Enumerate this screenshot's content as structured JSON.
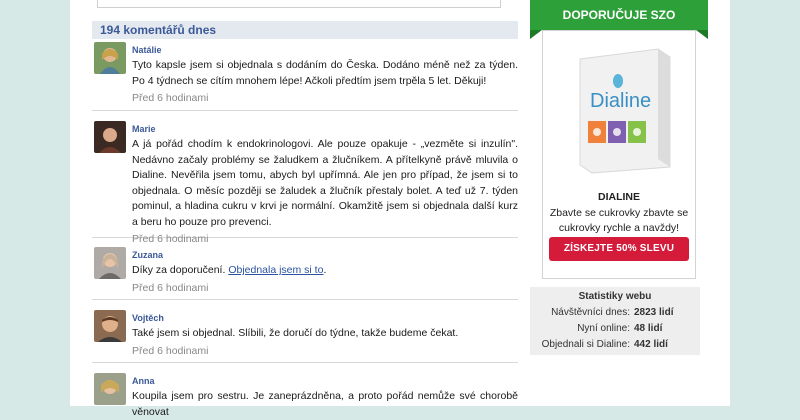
{
  "comments_header": "194 komentářů dnes",
  "comments": [
    {
      "name": "Natálie",
      "text": "Tyto kapsle jsem si objednala s dodáním do Česka. Dodáno méně než za týden. Po 4 týdnech se cítím mnohem lépe! Ačkoli předtím jsem trpěla 5 let. Děkuji!",
      "time": "Před 6 hodinami"
    },
    {
      "name": "Marie",
      "text": "A já pořád chodím k endokrinologovi. Ale pouze opakuje - „vezměte si inzulín\". Nedávno začaly problémy se žaludkem a žlučníkem. A přítelkyně právě mluvila o Dialine. Nevěřila jsem tomu, abych byl upřímná. Ale jen pro případ, že jsem si to objednala. O měsíc později se žaludek a žlučník přestaly bolet. A teď už 7. týden pominul, a hladina cukru v krvi je normální. Okamžitě jsem si objednala další kurz a beru ho pouze pro prevenci.",
      "time": "Před 6 hodinami"
    },
    {
      "name": "Zuzana",
      "text": "Díky za doporučení. ",
      "link": "Objednala jsem si to",
      "text_after": ".",
      "time": "Před 6 hodinami"
    },
    {
      "name": "Vojtěch",
      "text": "Také jsem si objednal. Slíbili, že doručí do týdne, takže budeme čekat.",
      "time": "Před 6 hodinami"
    },
    {
      "name": "Anna",
      "text": "Koupila jsem pro sestru. Je zaneprázdněna, a proto pořád nemůže své chorobě věnovat",
      "time": ""
    }
  ],
  "sidebar": {
    "banner": "DOPORUČUJE SZO",
    "product_name_on_box": "Dialine",
    "product_title": "DIALINE",
    "product_desc": "Zbavte se cukrovky zbavte se cukrovky rychle a navždy!",
    "cta": "ZÍSKEJTE 50% SLEVU"
  },
  "stats": {
    "title": "Statistiky webu",
    "rows": [
      {
        "label": "Návštěvníci dnes:",
        "value": "2823 lidí"
      },
      {
        "label": "Nyní online:",
        "value": "48 lidí"
      },
      {
        "label": "Objednali si Dialine:",
        "value": "442 lidí"
      }
    ]
  },
  "colors": {
    "accent_green": "#2ea03a",
    "cta_red": "#d41b3a",
    "name_blue": "#3b5998",
    "background": "#d6e9e6"
  }
}
